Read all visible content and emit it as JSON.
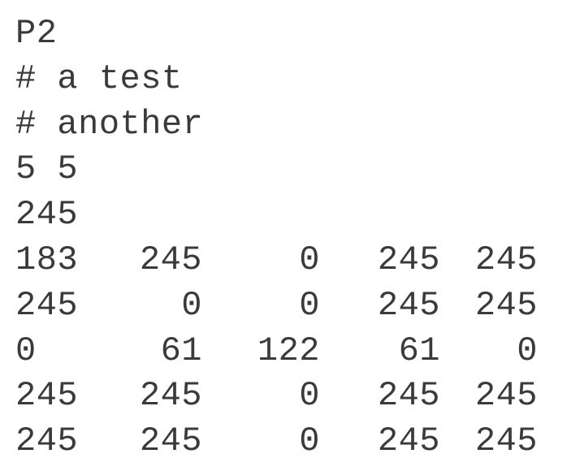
{
  "header": {
    "magic": "P2",
    "comments": [
      "# a test",
      "# another"
    ],
    "dimensions": "5 5",
    "maxval": "245"
  },
  "pixels": [
    [
      "183",
      "245",
      "0",
      "245",
      "245"
    ],
    [
      "245",
      "0",
      "0",
      "245",
      "245"
    ],
    [
      "0",
      "61",
      "122",
      "61",
      "0"
    ],
    [
      "245",
      "245",
      "0",
      "245",
      "245"
    ],
    [
      "245",
      "245",
      "0",
      "245",
      "245"
    ]
  ]
}
